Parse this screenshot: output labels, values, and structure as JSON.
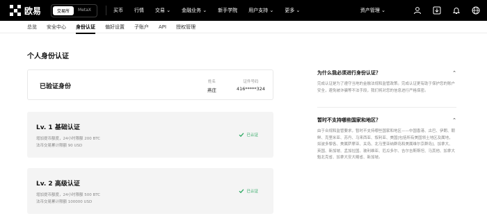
{
  "brand": {
    "name": "欧易"
  },
  "account_switch": {
    "active": "交易所",
    "other": "MetaX"
  },
  "top_nav": [
    "买币",
    "行情",
    "交易 ⌄",
    "金融业务 ⌄",
    "新手学院",
    "用户支持 ⌄",
    "更多 ⌄"
  ],
  "top_right": {
    "asset_label": "资产管理 ⌄"
  },
  "sub_nav": [
    "总览",
    "安全中心",
    "身份认证",
    "偏好设置",
    "子账户",
    "API",
    "授权管理"
  ],
  "page": {
    "title": "个人身份认证",
    "verified": {
      "title": "已验证身份",
      "name_label": "姓名",
      "name_value": "燕庄",
      "id_label": "证件号码",
      "id_value": "416*****324"
    },
    "levels": [
      {
        "title": "Lv. 1 基础认证",
        "line1": "增加提币额度，24小时限额 200 BTC",
        "line2": "法币交易累计限额 90 USD",
        "status": "已认证"
      },
      {
        "title": "Lv. 2 高级认证",
        "line1": "增加提币额度，24小时限额 500 BTC",
        "line2": "法币交易累计限额 100000 USD",
        "status": "已认证"
      }
    ]
  },
  "faq": [
    {
      "question": "为什么我必须进行身份认证？",
      "answer": "完成认证是为了遵守当地的金融法规和监管政策。完成认证更有助于保护您的账户安全，避免被诈骗等不法手段，我们将对您的信息进行严格保密。"
    },
    {
      "question": "暂时不支持哪些国家和地区？",
      "answer": "由于合规和监管要求，暂时不支持哪些国家和地区——中国香港、古巴、伊朗、朝鲜、克里米亚、苏丹、马来西亚、叙利亚、美国[包括所有美国领土地区及属地，如波多黎各、美属萨摩亚、关岛、北马里亚纳群岛和美属维尔京群岛]、加拿大、英国、新加坡、孟加拉国、玻利维亚、厄瓜多尔、吉尔吉斯斯坦、马其他、加拿大魁北克省、加拿大安大略省、新加坡。"
    }
  ]
}
